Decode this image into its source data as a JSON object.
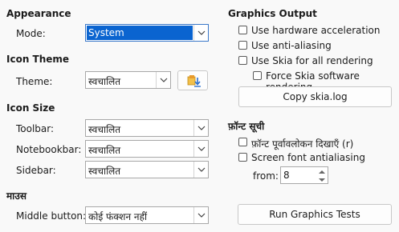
{
  "appearance": {
    "heading": "Appearance",
    "mode_label": "Mode:",
    "mode_value": "System"
  },
  "icon_theme": {
    "heading": "Icon Theme",
    "theme_label": "Theme:",
    "theme_value": "स्वचालित"
  },
  "icon_size": {
    "heading": "Icon Size",
    "toolbar_label": "Toolbar:",
    "toolbar_value": "स्वचालित",
    "notebookbar_label": "Notebookbar:",
    "notebookbar_value": "स्वचालित",
    "sidebar_label": "Sidebar:",
    "sidebar_value": "स्वचालित"
  },
  "mouse": {
    "heading": "माउस",
    "middle_button_label": "Middle button:",
    "middle_button_value": "कोई फंक्शन नहीं"
  },
  "graphics_output": {
    "heading": "Graphics Output",
    "hw_accel": "Use hardware acceleration",
    "anti_aliasing": "Use anti-aliasing",
    "skia_all": "Use Skia for all rendering",
    "force_skia_sw": "Force Skia software rendering",
    "copy_skia_log": "Copy skia.log"
  },
  "font_list": {
    "heading": "फ़ॉन्ट सूची",
    "preview_fonts": "फ़ॉन्ट पूर्वावलोकन दिखाएँ (r)",
    "screen_aa": "Screen font antialiasing",
    "from_label": "from:",
    "from_value": "8"
  },
  "run_tests": "Run Graphics Tests"
}
